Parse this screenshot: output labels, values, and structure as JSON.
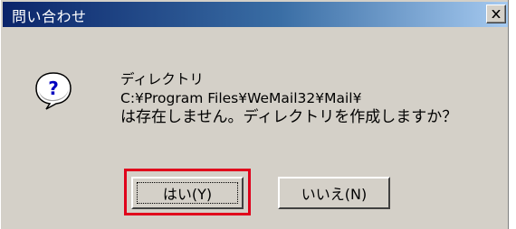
{
  "dialog": {
    "title": "問い合わせ",
    "close_label": "×",
    "icon": "question-icon",
    "message": {
      "line1": "ディレクトリ",
      "line2": "C:¥Program Files¥WeMail32¥Mail¥",
      "line3": "は存在しません。ディレクトリを作成しますか？"
    },
    "buttons": {
      "yes_label": "はい(Y)",
      "no_label": "いいえ(N)"
    },
    "colors": {
      "title_gradient_start": "#0a246a",
      "title_gradient_end": "#a6caf0",
      "face": "#d4d0c8",
      "highlight": "#e0001b"
    }
  }
}
